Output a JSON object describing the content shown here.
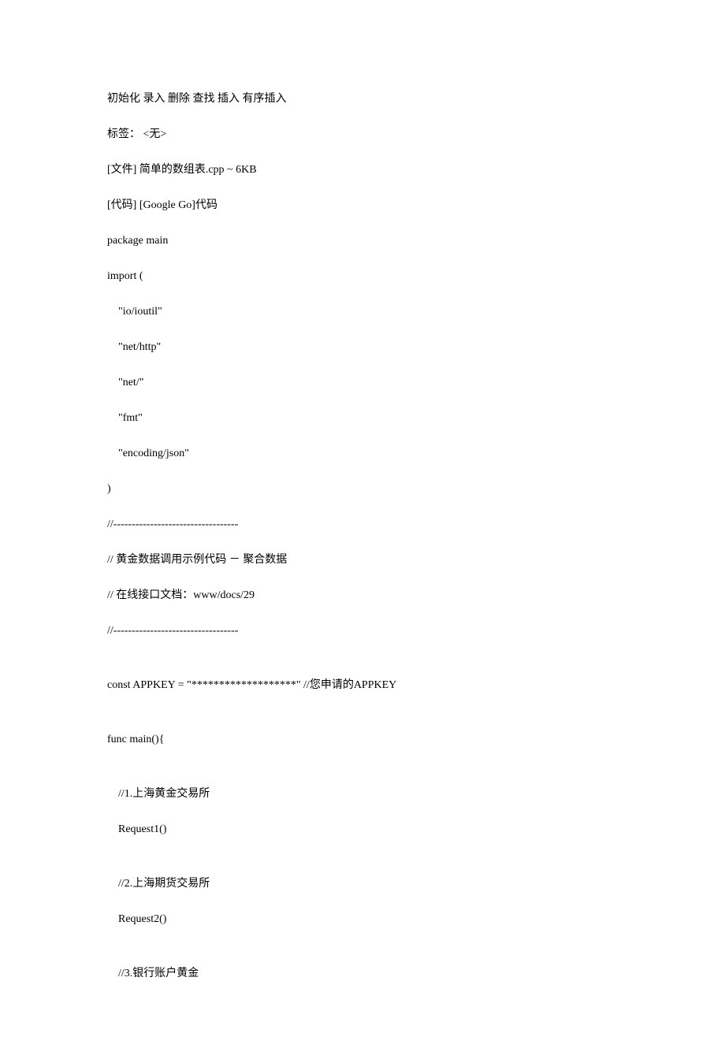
{
  "lines": [
    "初始化 录入 删除 查找 插入 有序插入",
    "标签： <无>",
    "[文件] 简单的数组表.cpp ~ 6KB",
    "[代码] [Google Go]代码",
    "package main",
    "import (",
    "    \"io/ioutil\"",
    "    \"net/http\"",
    "    \"net/\"",
    "    \"fmt\"",
    "    \"encoding/json\"",
    ")",
    "//----------------------------------",
    "// 黄金数据调用示例代码 － 聚合数据",
    "// 在线接口文档：www/docs/29",
    "//----------------------------------",
    "",
    "const APPKEY = \"*******************\" //您申请的APPKEY",
    "",
    "func main(){",
    "",
    "    //1.上海黄金交易所",
    "    Request1()",
    "",
    "    //2.上海期货交易所",
    "    Request2()",
    "",
    "    //3.银行账户黄金"
  ]
}
